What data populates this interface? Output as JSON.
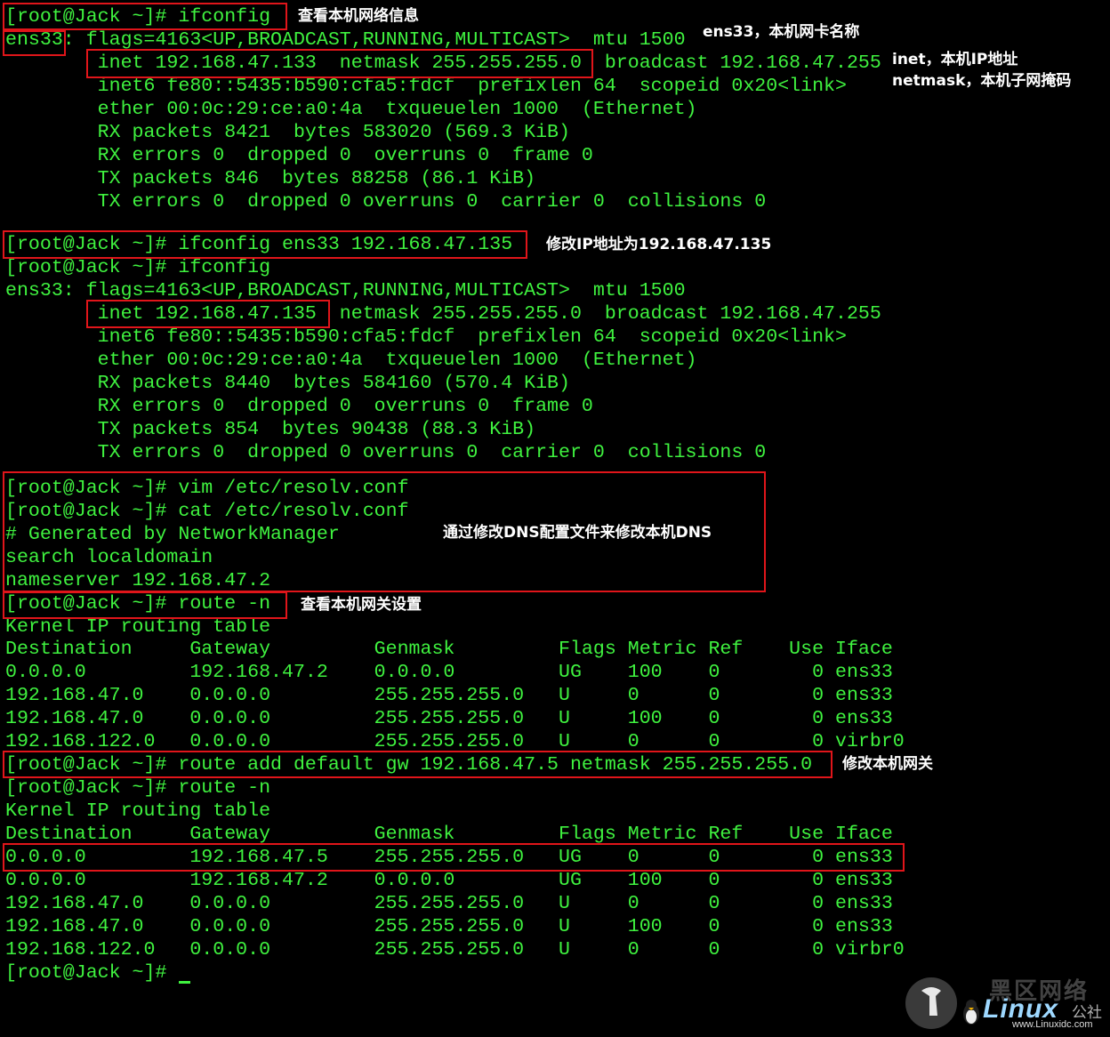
{
  "terminal": {
    "lines": [
      "[root@Jack ~]# ifconfig",
      "ens33: flags=4163<UP,BROADCAST,RUNNING,MULTICAST>  mtu 1500",
      "        inet 192.168.47.133  netmask 255.255.255.0  broadcast 192.168.47.255",
      "        inet6 fe80::5435:b590:cfa5:fdcf  prefixlen 64  scopeid 0x20<link>",
      "        ether 00:0c:29:ce:a0:4a  txqueuelen 1000  (Ethernet)",
      "        RX packets 8421  bytes 583020 (569.3 KiB)",
      "        RX errors 0  dropped 0  overruns 0  frame 0",
      "        TX packets 846  bytes 88258 (86.1 KiB)",
      "        TX errors 0  dropped 0 overruns 0  carrier 0  collisions 0",
      "",
      "[root@Jack ~]# ifconfig ens33 192.168.47.135",
      "[root@Jack ~]# ifconfig",
      "ens33: flags=4163<UP,BROADCAST,RUNNING,MULTICAST>  mtu 1500",
      "        inet 192.168.47.135  netmask 255.255.255.0  broadcast 192.168.47.255",
      "        inet6 fe80::5435:b590:cfa5:fdcf  prefixlen 64  scopeid 0x20<link>",
      "        ether 00:0c:29:ce:a0:4a  txqueuelen 1000  (Ethernet)",
      "        RX packets 8440  bytes 584160 (570.4 KiB)",
      "        RX errors 0  dropped 0  overruns 0  frame 0",
      "        TX packets 854  bytes 90438 (88.3 KiB)",
      "        TX errors 0  dropped 0 overruns 0  carrier 0  collisions 0",
      "",
      "[root@Jack ~]# vim /etc/resolv.conf",
      "[root@Jack ~]# cat /etc/resolv.conf",
      "# Generated by NetworkManager",
      "search localdomain",
      "nameserver 192.168.47.2",
      "[root@Jack ~]# route -n",
      "Kernel IP routing table",
      "Destination     Gateway         Genmask         Flags Metric Ref    Use Iface",
      "0.0.0.0         192.168.47.2    0.0.0.0         UG    100    0        0 ens33",
      "192.168.47.0    0.0.0.0         255.255.255.0   U     0      0        0 ens33",
      "192.168.47.0    0.0.0.0         255.255.255.0   U     100    0        0 ens33",
      "192.168.122.0   0.0.0.0         255.255.255.0   U     0      0        0 virbr0",
      "[root@Jack ~]# route add default gw 192.168.47.5 netmask 255.255.255.0",
      "[root@Jack ~]# route -n",
      "Kernel IP routing table",
      "Destination     Gateway         Genmask         Flags Metric Ref    Use Iface",
      "0.0.0.0         192.168.47.5    255.255.255.0   UG    0      0        0 ens33",
      "0.0.0.0         192.168.47.2    0.0.0.0         UG    100    0        0 ens33",
      "192.168.47.0    0.0.0.0         255.255.255.0   U     0      0        0 ens33",
      "192.168.47.0    0.0.0.0         255.255.255.0   U     100    0        0 ens33",
      "192.168.122.0   0.0.0.0         255.255.255.0   U     0      0        0 virbr0",
      "[root@Jack ~]# "
    ]
  },
  "annotations": {
    "view_network": "查看本机网络信息",
    "nic_name": "ens33，本机网卡名称",
    "inet_ip": "inet，本机IP地址",
    "netmask": "netmask，本机子网掩码",
    "modify_ip": "修改IP地址为192.168.47.135",
    "modify_dns": "通过修改DNS配置文件来修改本机DNS",
    "view_gateway": "查看本机网关设置",
    "modify_gateway": "修改本机网关"
  },
  "watermark": {
    "brand": "Linux",
    "cn_top": "黑区网络",
    "cn_side": "公社",
    "url": "www.Linuxidc.com"
  },
  "colors": {
    "terminal_bg": "#000000",
    "terminal_text": "#3ff23f",
    "highlight_box": "#e0151a",
    "annotation_text": "#ffffff"
  }
}
